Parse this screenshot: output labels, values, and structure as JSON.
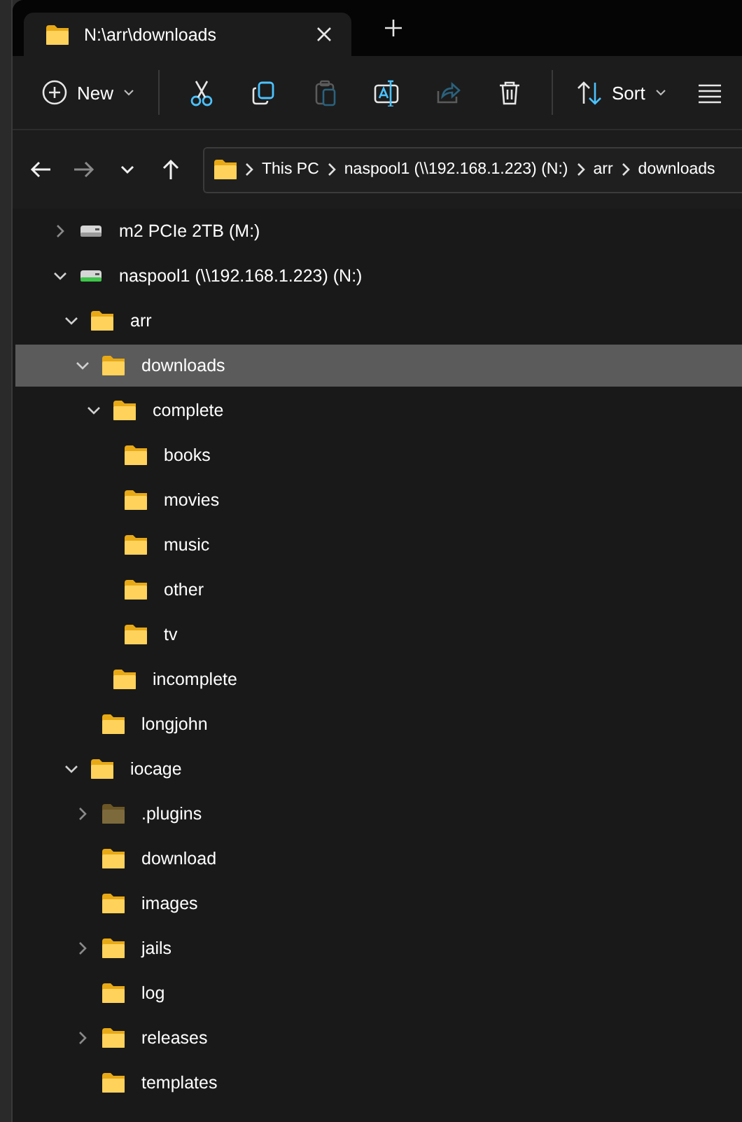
{
  "tabs": [
    {
      "title": "N:\\arr\\downloads",
      "selected": true
    }
  ],
  "toolbar": {
    "items": [
      {
        "kind": "new",
        "label": "New",
        "disabled": false
      },
      {
        "kind": "cut",
        "disabled": false
      },
      {
        "kind": "copy",
        "disabled": false
      },
      {
        "kind": "paste",
        "disabled": true
      },
      {
        "kind": "rename",
        "disabled": false
      },
      {
        "kind": "share",
        "disabled": true
      },
      {
        "kind": "delete",
        "disabled": false
      },
      {
        "kind": "sort",
        "label": "Sort",
        "disabled": false
      },
      {
        "kind": "view",
        "disabled": false
      }
    ]
  },
  "navigation": [
    {
      "kind": "back",
      "disabled": false
    },
    {
      "kind": "forward",
      "disabled": true
    },
    {
      "kind": "recent",
      "disabled": false
    },
    {
      "kind": "up",
      "disabled": false
    }
  ],
  "address": {
    "crumbs": [
      "This PC",
      "naspool1 (\\\\192.168.1.223) (N:)",
      "arr",
      "downloads"
    ]
  },
  "tree": [
    {
      "label": "m2 PCIe 2TB (M:)",
      "kind": "drive",
      "expandable": true,
      "expanded": false,
      "selected": false
    },
    {
      "label": "naspool1 (\\\\192.168.1.223) (N:)",
      "kind": "network-drive",
      "expandable": true,
      "expanded": true,
      "selected": false,
      "children": [
        {
          "label": "arr",
          "kind": "folder",
          "expandable": true,
          "expanded": true,
          "selected": false,
          "children": [
            {
              "label": "downloads",
              "kind": "folder",
              "expandable": true,
              "expanded": true,
              "selected": true,
              "children": [
                {
                  "label": "complete",
                  "kind": "folder",
                  "expandable": true,
                  "expanded": true,
                  "selected": false,
                  "children": [
                    {
                      "label": "books",
                      "kind": "folder",
                      "expandable": false,
                      "selected": false
                    },
                    {
                      "label": "movies",
                      "kind": "folder",
                      "expandable": false,
                      "selected": false
                    },
                    {
                      "label": "music",
                      "kind": "folder",
                      "expandable": false,
                      "selected": false
                    },
                    {
                      "label": "other",
                      "kind": "folder",
                      "expandable": false,
                      "selected": false
                    },
                    {
                      "label": "tv",
                      "kind": "folder",
                      "expandable": false,
                      "selected": false
                    }
                  ]
                },
                {
                  "label": "incomplete",
                  "kind": "folder",
                  "expandable": false,
                  "selected": false
                }
              ]
            },
            {
              "label": "longjohn",
              "kind": "folder",
              "expandable": false,
              "selected": false
            }
          ]
        },
        {
          "label": "iocage",
          "kind": "folder",
          "expandable": true,
          "expanded": true,
          "selected": false,
          "children": [
            {
              "label": ".plugins",
              "kind": "hidden-folder",
              "expandable": true,
              "expanded": false,
              "selected": false
            },
            {
              "label": "download",
              "kind": "folder",
              "expandable": false,
              "selected": false
            },
            {
              "label": "images",
              "kind": "folder",
              "expandable": false,
              "selected": false
            },
            {
              "label": "jails",
              "kind": "folder",
              "expandable": true,
              "expanded": false,
              "selected": false
            },
            {
              "label": "log",
              "kind": "folder",
              "expandable": false,
              "selected": false
            },
            {
              "label": "releases",
              "kind": "folder",
              "expandable": true,
              "expanded": false,
              "selected": false
            },
            {
              "label": "templates",
              "kind": "folder",
              "expandable": false,
              "selected": false
            }
          ]
        }
      ]
    }
  ]
}
